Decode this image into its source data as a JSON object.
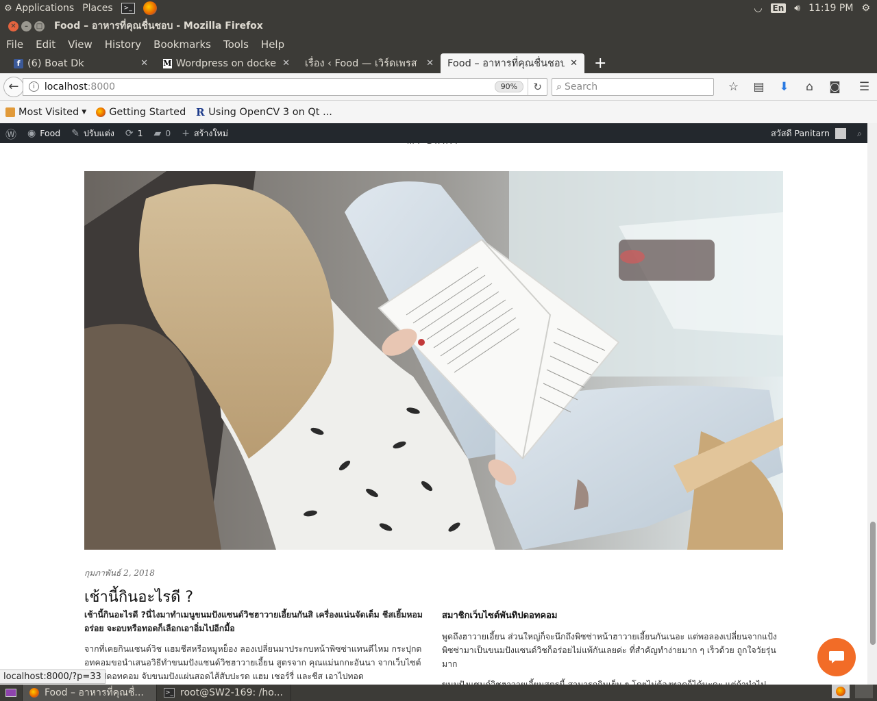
{
  "top_panel": {
    "applications": "Applications",
    "places": "Places",
    "keyboard": "En",
    "time": "11:19 PM"
  },
  "window": {
    "title": "Food – อาหารที่คุณชื่นชอบ - Mozilla Firefox"
  },
  "menu": [
    "File",
    "Edit",
    "View",
    "History",
    "Bookmarks",
    "Tools",
    "Help"
  ],
  "tabs": [
    {
      "label": "(6) Boat Dk",
      "icon": "facebook-icon"
    },
    {
      "label": "Wordpress on docker ·",
      "icon": "medium-icon"
    },
    {
      "label": "เรื่อง ‹ Food — เวิร์ดเพรส",
      "icon": ""
    },
    {
      "label": "Food – อาหารที่คุณชื่นชอบ",
      "icon": ""
    }
  ],
  "navbar": {
    "url_host": "localhost",
    "url_port": ":8000",
    "zoom": "90%",
    "search_placeholder": "Search"
  },
  "bookmarks": [
    {
      "label": "Most Visited",
      "icon": "folder-icon"
    },
    {
      "label": "Getting Started",
      "icon": "firefox-icon"
    },
    {
      "label": "Using OpenCV 3 on Qt ...",
      "icon": "r-icon"
    }
  ],
  "wp_admin": {
    "site": "Food",
    "customize": "ปรับแต่ง",
    "updates": "1",
    "comments": "0",
    "new": "สร้างใหม่",
    "greeting": "สวัสดี Panitarn"
  },
  "site": {
    "description": "— MY DIARY —"
  },
  "post": {
    "date": "กุมภาพันธ์ 2, 2018",
    "title": "เช้านี้กินอะไรดี ?",
    "lead": "เช้านี้กินอะไรดี ?นี่ไงมาทำเมนูขนมปังแซนด์วิชฮาวายเอี้ยนกันสิ เครื่องแน่นจัดเต็ม ชีสเยิ้มหอมอร่อย จะอบหรือทอดก็เลือกเอาอิ่มไปอีกมื้อ",
    "para1": "จากที่เคยกินแซนด์วิช แฮมชีสหรือหมูหย็อง ลองเปลี่ยนมาประกบหน้าพิซซ่าแทนดีไหม กระปุกดอทคอมขอนำเสนอวิธีทำขนมปังแซนด์วิชฮาวายเอี้ยน สูตรจาก คุณแม่นกกะอันนา จากเว็บไซต์พันทิปดอทคอม จับขนมปังแผ่นสอดไส้สับปะรด แฮม เชอร์รี่ และชีส เอาไปทอด",
    "col2_head": "สมาชิกเว็บไซต์พันทิปดอทคอม",
    "col2_p1": "พูดถึงฮาวายเอี้ยน ส่วนใหญ่ก็จะนึกถึงพิซซ่าหน้าฮาวายเอี้ยนกันเนอะ แต่พอลองเปลี่ยนจากแป้งพิซซ่ามาเป็นขนมปังแซนด์วิชก็อร่อยไม่แพ้กันเลยค่ะ ที่สำคัญทำง่ายมาก ๆ เร็วด้วย ถูกใจวัยรุ่นมาก",
    "col2_p2": "ขนมปังแซนด์วิชฮาวายเอี้ยนสูตรนี้ สามารถกินเย็น ๆ โดยไม่ต้องทอดก็ได้นะคะ แต่ถ้านำไป"
  },
  "status_url": "localhost:8000/?p=33",
  "taskbar": [
    {
      "label": "Food – อาหารที่คุณชื่...",
      "icon": "firefox-icon",
      "active": true
    },
    {
      "label": "root@SW2-169: /ho...",
      "icon": "terminal-icon",
      "active": false
    }
  ]
}
